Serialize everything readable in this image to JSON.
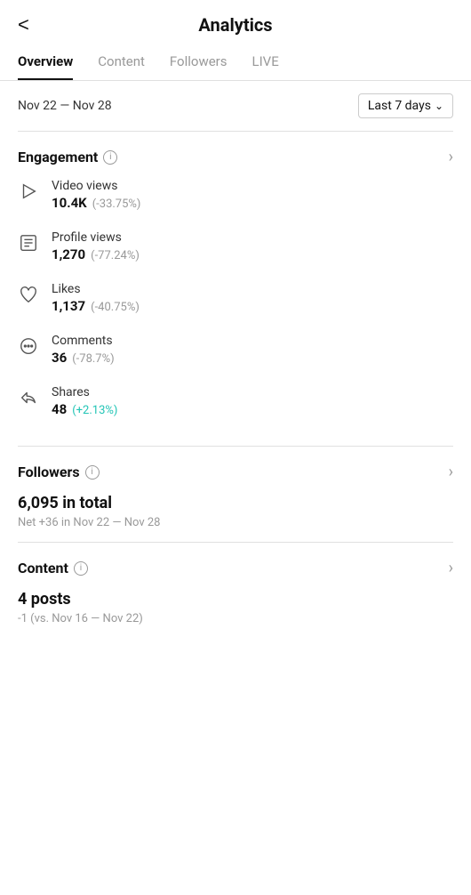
{
  "header": {
    "back_label": "<",
    "title": "Analytics"
  },
  "tabs": [
    {
      "label": "Overview",
      "active": true
    },
    {
      "label": "Content",
      "active": false
    },
    {
      "label": "Followers",
      "active": false
    },
    {
      "label": "LIVE",
      "active": false
    }
  ],
  "date_range": {
    "label": "Nov 22 — Nov 28",
    "filter": "Last 7 days"
  },
  "engagement": {
    "section_title": "Engagement",
    "info_label": "i",
    "metrics": [
      {
        "icon": "play-icon",
        "name": "Video views",
        "value": "10.4K",
        "change": "(-33.75%)",
        "positive": false
      },
      {
        "icon": "profile-icon",
        "name": "Profile views",
        "value": "1,270",
        "change": "(-77.24%)",
        "positive": false
      },
      {
        "icon": "heart-icon",
        "name": "Likes",
        "value": "1,137",
        "change": "(-40.75%)",
        "positive": false
      },
      {
        "icon": "comment-icon",
        "name": "Comments",
        "value": "36",
        "change": "(-78.7%)",
        "positive": false
      },
      {
        "icon": "share-icon",
        "name": "Shares",
        "value": "48",
        "change": "(+2.13%)",
        "positive": true
      }
    ]
  },
  "followers": {
    "section_title": "Followers",
    "info_label": "i",
    "total_text": "6,095",
    "total_suffix": " in total",
    "net_text": "Net +36 in Nov 22 — Nov 28"
  },
  "content": {
    "section_title": "Content",
    "info_label": "i",
    "posts_value": "4",
    "posts_label": " posts",
    "vs_text": "-1 (vs. Nov 16 — Nov 22)"
  }
}
